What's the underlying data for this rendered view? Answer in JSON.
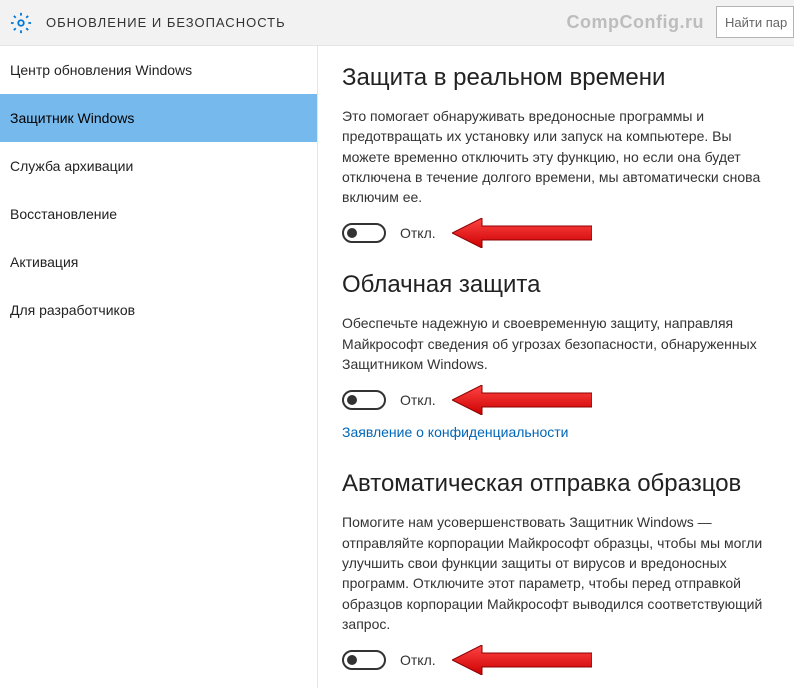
{
  "header": {
    "title": "ОБНОВЛЕНИЕ И БЕЗОПАСНОСТЬ",
    "watermark": "CompConfig.ru",
    "searchPlaceholder": "Найти пар"
  },
  "sidebar": {
    "items": [
      {
        "label": "Центр обновления Windows",
        "selected": false
      },
      {
        "label": "Защитник Windows",
        "selected": true
      },
      {
        "label": "Служба архивации",
        "selected": false
      },
      {
        "label": "Восстановление",
        "selected": false
      },
      {
        "label": "Активация",
        "selected": false
      },
      {
        "label": "Для разработчиков",
        "selected": false
      }
    ]
  },
  "sections": {
    "realtime": {
      "title": "Защита в реальном времени",
      "desc": "Это помогает обнаруживать вредоносные программы и предотвращать их установку или запуск на компьютере. Вы можете временно отключить эту функцию, но если она будет отключена в течение долгого времени, мы автоматически снова включим ее.",
      "toggleLabel": "Откл."
    },
    "cloud": {
      "title": "Облачная защита",
      "desc": "Обеспечьте надежную и своевременную защиту, направляя Майкрософт сведения об угрозах безопасности, обнаруженных Защитником Windows.",
      "toggleLabel": "Откл.",
      "privacyLink": "Заявление о конфиденциальности"
    },
    "samples": {
      "title": "Автоматическая отправка образцов",
      "desc": "Помогите нам усовершенствовать Защитник Windows — отправляйте корпорации Майкрософт образцы, чтобы мы могли улучшить свои функции защиты от вирусов и вредоносных программ. Отключите этот параметр, чтобы перед отправкой образцов корпорации Майкрософт выводился соответствующий запрос.",
      "toggleLabel": "Откл."
    }
  }
}
